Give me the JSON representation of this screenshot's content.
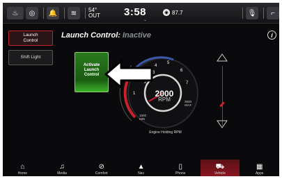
{
  "status_bar": {
    "temp_value": "54°",
    "temp_label": "OUT",
    "time": "3:58",
    "range_value": "87.7"
  },
  "sidebar": {
    "items": [
      {
        "label": "Launch Control"
      },
      {
        "label": "Shift Light"
      }
    ]
  },
  "header": {
    "title": "Launch Control:",
    "status": "Inactive",
    "info_icon": "i"
  },
  "activate_button": {
    "label": "Activate Launch Control"
  },
  "gauge": {
    "rpm_value": "2000",
    "rpm_unit": "RPM",
    "ticks": [
      "1",
      "2",
      "3",
      "4",
      "5",
      "6",
      "7"
    ],
    "min_label": "1500 MIN",
    "max_label": "3500 MAX",
    "caption": "Engine Holding RPM"
  },
  "nav": {
    "items": [
      {
        "label": "Home",
        "icon": "home-icon"
      },
      {
        "label": "Media",
        "icon": "music-note-icon"
      },
      {
        "label": "Comfort",
        "icon": "comfort-icon"
      },
      {
        "label": "Nav",
        "icon": "navigation-arrow-icon"
      },
      {
        "label": "Phone",
        "icon": "phone-icon"
      },
      {
        "label": "Vehicle",
        "icon": "car-icon"
      },
      {
        "label": "Apps",
        "icon": "apps-grid-icon"
      }
    ]
  },
  "colors": {
    "accent_red": "#c8232b",
    "active_green": "#2a7a1e",
    "status_gray": "#8a8f95"
  }
}
